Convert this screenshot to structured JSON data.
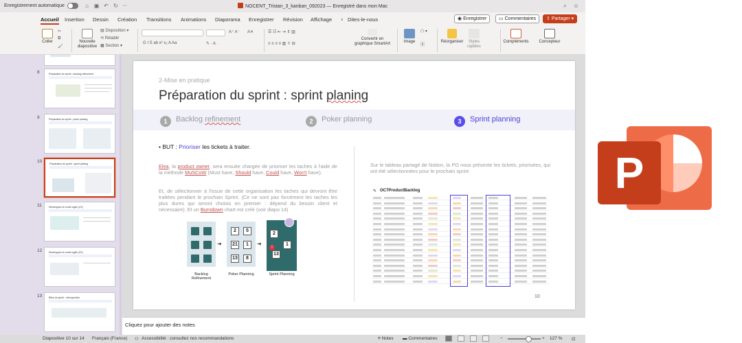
{
  "titlebar": {
    "autosave_label": "Enregistrement automatique",
    "document_title": "NOCENT_Tristan_3_kanban_092023 — Enregistré dans mon Mac",
    "more": "···"
  },
  "menu": {
    "tabs": [
      "Accueil",
      "Insertion",
      "Dessin",
      "Création",
      "Transitions",
      "Animations",
      "Diaporama",
      "Enregistrer",
      "Révision",
      "Affichage",
      "Dites-le-nous"
    ],
    "record_button": "Enregistrer",
    "comments_button": "Commentaires",
    "share_button": "Partager"
  },
  "ribbon": {
    "paste": "Coller",
    "new_slide": "Nouvelle diapositive",
    "layout": "Disposition",
    "reset": "Rétablir",
    "section": "Section",
    "convert_smartart": "Convertir en graphique SmartArt",
    "image": "Image",
    "arrange": "Réorganiser",
    "quick_styles": "Styles rapides",
    "addins": "Compléments",
    "designer": "Concepteur"
  },
  "thumbnails": [
    {
      "num": "8",
      "title": "Préparation du sprint : backlog refinement"
    },
    {
      "num": "9",
      "title": "Préparation du sprint : poker planing"
    },
    {
      "num": "10",
      "title": "Préparation du sprint : sprint planing"
    },
    {
      "num": "11",
      "title": "Développez en mode agile (1/2)"
    },
    {
      "num": "12",
      "title": "Développez en mode agile (2/2)"
    },
    {
      "num": "13",
      "title": "Bilan du sprint : rétrospective"
    }
  ],
  "slide": {
    "supertitle": "2-Mise en pratique",
    "title_part1": "Préparation du sprint : sprint ",
    "title_part2": "planing",
    "steps": [
      {
        "num": "1",
        "label_a": "Backlog ",
        "label_b": "refinement"
      },
      {
        "num": "2",
        "label": "Poker planning"
      },
      {
        "num": "3",
        "label": "Sprint planning"
      }
    ],
    "goal_prefix": "• BUT : ",
    "goal_highlight": "Prioriser",
    "goal_suffix": " les tickets à traiter.",
    "para1": {
      "w1": "Elea",
      "t1": ", la ",
      "w2": "product owner",
      "t2": ", sera ensuite chargée de prioriser les taches à l'aide de la méthode ",
      "w3": "MuSCoW",
      "t3": " (Must have, ",
      "w4": "Should",
      "t4": " have, ",
      "w5": "Could",
      "t5": " have, ",
      "w6": "Won't",
      "t6": " have)."
    },
    "para2": {
      "t1": "Et, de sélectionner à l'issue de cette organisation les taches qui devront être traitées pendant le prochain Sprint. (Ce ne sont pas forcément les taches les plus dures qui seront choisis en premier : dépend du besoin client et nécessaire). Et un ",
      "w1": "Burndown",
      "t2": " chart est créé (voir diapo 14)"
    },
    "illustration": {
      "col1_label": "Backlog Refinement",
      "col2_label": "Poker Planning",
      "col3_label": "Sprint Planning",
      "col2_cards": [
        "2",
        "5",
        "21",
        "1",
        "13",
        "8"
      ],
      "col3_cards": [
        "2",
        "1",
        "13"
      ]
    },
    "right_text": "Sur le tableau partagé de Notion, la PO nous présente les tickets, priorisées, qui ont été sélectionnées pour le prochain sprint",
    "notion_title": "OC7ProductBacklog",
    "page_number": "10"
  },
  "notes_placeholder": "Cliquez pour ajouter des notes",
  "statusbar": {
    "slide_info": "Diapositive 10 sur 14",
    "language": "Français (France)",
    "accessibility": "Accessibilité : consultez nos recommandations",
    "notes": "Notes",
    "comments": "Commentaires",
    "zoom": "127 %"
  },
  "colors": {
    "accent": "#c43e1c",
    "step_active": "#5b4dea",
    "sidebar_bg": "#e3dcea"
  }
}
